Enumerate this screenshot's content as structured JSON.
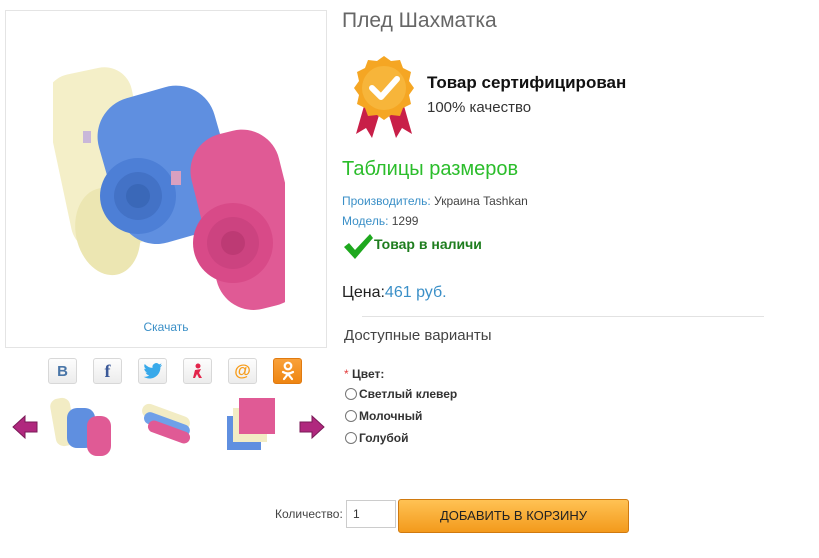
{
  "product": {
    "title": "Плед Шахматка",
    "download_label": "Скачать"
  },
  "certificate": {
    "title": "Товар сертифицирован",
    "subtitle": "100% качество",
    "icon": "certified-badge-icon",
    "color": "#f5a623"
  },
  "size_table_link": "Таблицы размеров",
  "manufacturer": {
    "key": "Производитель:",
    "value": "Украина Tashkan"
  },
  "model": {
    "key": "Модель:",
    "value": "1299"
  },
  "stock": {
    "label": "Товар в наличи",
    "icon": "checkmark-icon"
  },
  "price": {
    "key": "Цена:",
    "value": "461 руб."
  },
  "variants_heading": "Доступные варианты",
  "color_option": {
    "required_mark": "*",
    "label": "Цвет:",
    "options": [
      "Светлый клевер",
      "Молочный",
      "Голубой"
    ]
  },
  "quantity": {
    "label": "Количество:",
    "value": "1"
  },
  "cart_button": "ДОБАВИТЬ В КОРЗИНУ",
  "social": [
    {
      "name": "vk",
      "glyph": "B",
      "color": "#4a76a8"
    },
    {
      "name": "facebook",
      "glyph": "f",
      "color": "#3b5998"
    },
    {
      "name": "twitter",
      "glyph": "",
      "color": "#38a9ea"
    },
    {
      "name": "moimir",
      "glyph": "",
      "color": "#e2254b"
    },
    {
      "name": "mailru",
      "glyph": "@",
      "color": "#f79c1a"
    },
    {
      "name": "odnoklassniki",
      "glyph": "ok",
      "color": "#f28a1b"
    }
  ],
  "colors": {
    "accent_link": "#3a8fc7",
    "green": "#2bbd2b",
    "cart": "#f5a623",
    "arrow": "#b0287e"
  }
}
